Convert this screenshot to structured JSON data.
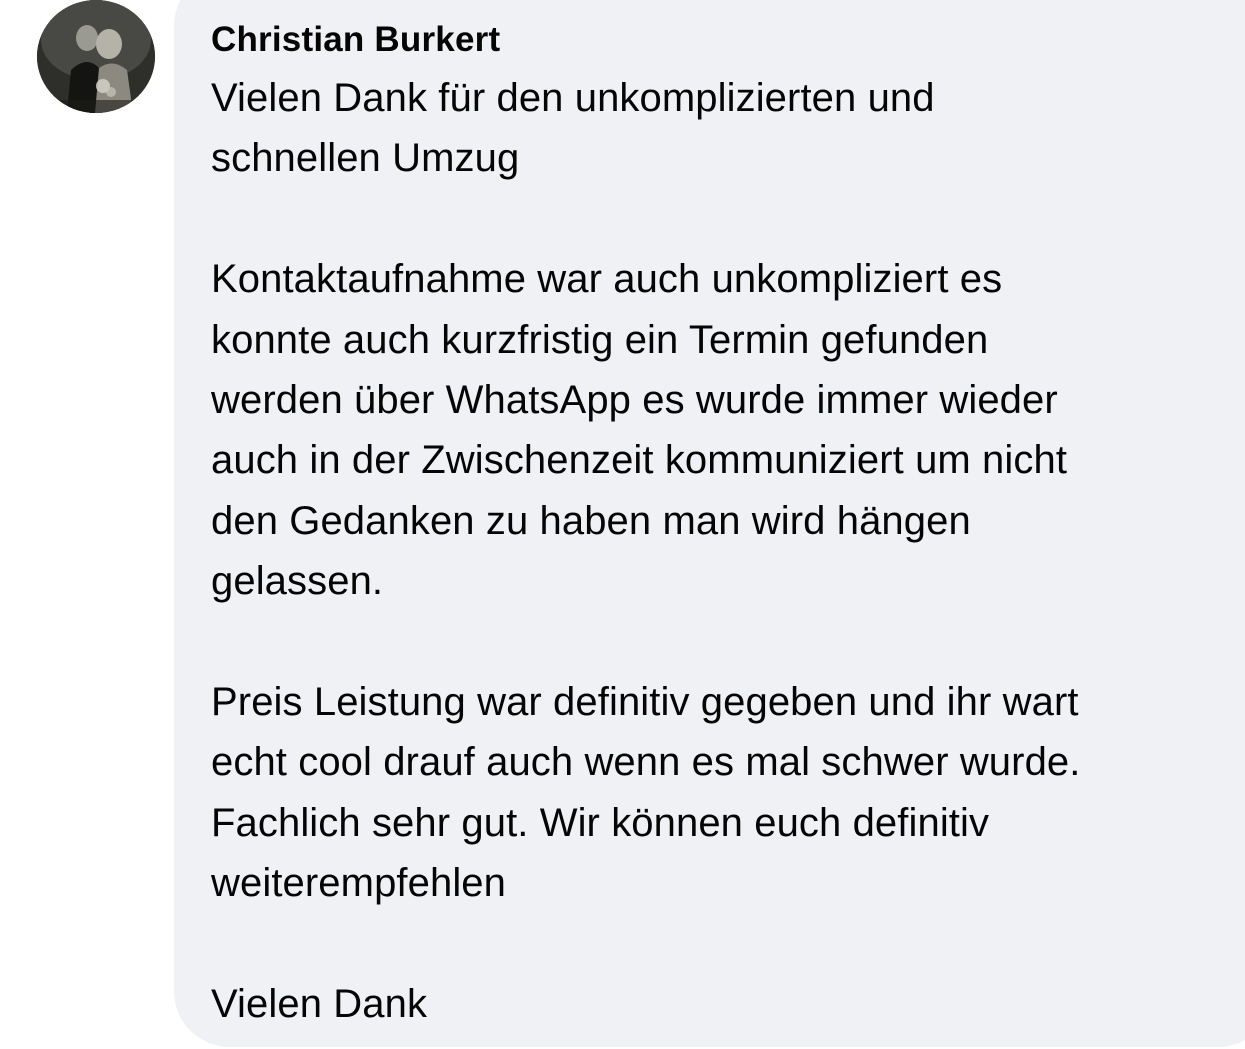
{
  "comment": {
    "author": "Christian Burkert",
    "avatar_icon": "profile-photo",
    "bubble_color": "#f0f1f5",
    "text_color": "#050505",
    "lines": [
      "Vielen Dank für den unkomplizierten und",
      "schnellen Umzug",
      "",
      "Kontaktaufnahme war auch unkompliziert es",
      "konnte auch kurzfristig ein Termin gefunden",
      "werden über WhatsApp es wurde immer wieder",
      "auch in der Zwischenzeit kommuniziert um nicht",
      "den Gedanken zu haben man wird hängen",
      "gelassen.",
      "",
      "Preis Leistung war definitiv gegeben und ihr wart",
      "echt cool drauf auch wenn es mal schwer wurde.",
      "Fachlich sehr gut. Wir können euch definitiv",
      "weiterempfehlen",
      "",
      "Vielen Dank"
    ]
  }
}
